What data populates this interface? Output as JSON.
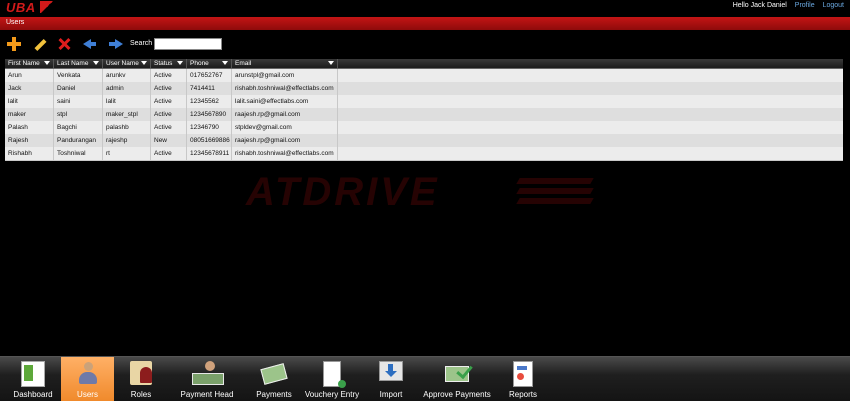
{
  "app": {
    "logo_text": "UBA"
  },
  "header": {
    "greeting": "Hello Jack Daniel",
    "profile_link": "Profile",
    "logout_link": "Logout"
  },
  "section": {
    "title": "Users"
  },
  "toolbar": {
    "icons": [
      "add-icon",
      "edit-icon",
      "delete-icon",
      "arrow-left-icon",
      "arrow-right-icon"
    ],
    "search_label": "Search",
    "search_value": "",
    "search_placeholder": ""
  },
  "table": {
    "columns": [
      "First Name",
      "Last Name",
      "User Name",
      "Status",
      "Phone",
      "Email"
    ],
    "rows": [
      [
        "Arun",
        "Venkata",
        "arunkv",
        "Active",
        "017652767",
        "arunstpl@gmail.com"
      ],
      [
        "Jack",
        "Daniel",
        "admin",
        "Active",
        "7414411",
        "rishabh.toshniwal@effectlabs.com"
      ],
      [
        "lalit",
        "saini",
        "lalit",
        "Active",
        "12345562",
        "lalit.saini@effectlabs.com"
      ],
      [
        "maker",
        "stpl",
        "maker_stpl",
        "Active",
        "1234567890",
        "raajesh.rp@gmail.com"
      ],
      [
        "Palash",
        "Bagchi",
        "palashb",
        "Active",
        "12346790",
        "stpldev@gmail.com"
      ],
      [
        "Rajesh",
        "Pandurangan",
        "rajeshp",
        "New",
        "08051669886",
        "raajesh.rp@gmail.com"
      ],
      [
        "Rishabh",
        "Toshniwal",
        "rt",
        "Active",
        "12345678911",
        "rishabh.toshniwal@effectlabs.com"
      ]
    ]
  },
  "watermark": {
    "text": "ATDRIVE"
  },
  "nav": {
    "items": [
      {
        "label": "Dashboard",
        "icon": "dashboard-icon",
        "active": false
      },
      {
        "label": "Users",
        "icon": "users-icon",
        "active": true
      },
      {
        "label": "Roles",
        "icon": "roles-icon",
        "active": false
      },
      {
        "label": "Payment Head",
        "icon": "payment-head-icon",
        "active": false
      },
      {
        "label": "Payments",
        "icon": "payments-icon",
        "active": false
      },
      {
        "label": "Vouchery Entry",
        "icon": "voucher-entry-icon",
        "active": false
      },
      {
        "label": "Import",
        "icon": "import-icon",
        "active": false
      },
      {
        "label": "Approve Payments",
        "icon": "approve-payments-icon",
        "active": false
      },
      {
        "label": "Reports",
        "icon": "reports-icon",
        "active": false
      }
    ]
  },
  "colors": {
    "accent_red": "#c41515",
    "active_nav": "#f08a2c",
    "link_blue": "#6aa8e0"
  }
}
